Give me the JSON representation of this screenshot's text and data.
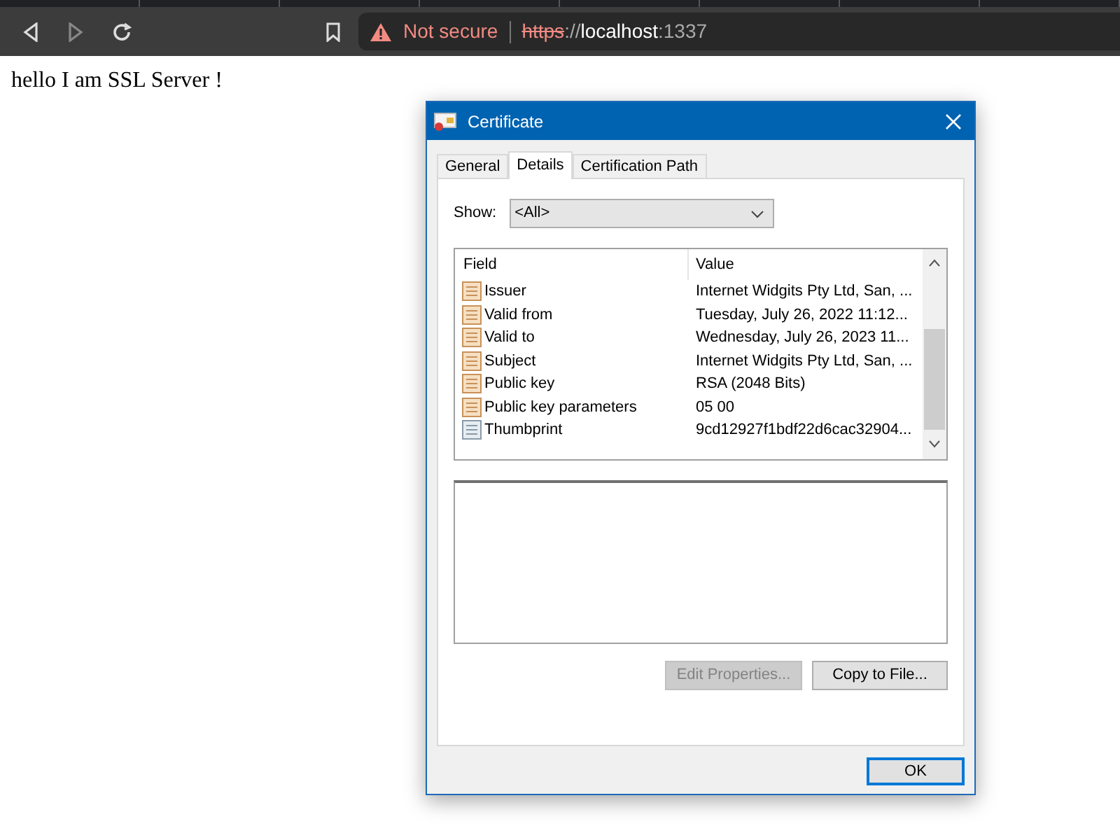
{
  "browser": {
    "security": "Not secure",
    "url_scheme": "https",
    "url_separator": "://",
    "url_host": "localhost",
    "url_port": ":1337",
    "back_disabled": false,
    "forward_disabled": true
  },
  "page": {
    "text": "hello I am SSL Server !"
  },
  "dialog": {
    "title": "Certificate",
    "tabs": [
      {
        "label": "General",
        "selected": false
      },
      {
        "label": "Details",
        "selected": true
      },
      {
        "label": "Certification Path",
        "selected": false
      }
    ],
    "show_label": "Show:",
    "show_value": "<All>",
    "columns": [
      "Field",
      "Value"
    ],
    "rows": [
      {
        "field": "Issuer",
        "value": "Internet Widgits Pty Ltd, San, ...",
        "kind": "extension"
      },
      {
        "field": "Valid from",
        "value": "Tuesday, July 26, 2022 11:12...",
        "kind": "extension"
      },
      {
        "field": "Valid to",
        "value": "Wednesday, July 26, 2023 11...",
        "kind": "extension"
      },
      {
        "field": "Subject",
        "value": "Internet Widgits Pty Ltd, San, ...",
        "kind": "extension"
      },
      {
        "field": "Public key",
        "value": "RSA (2048 Bits)",
        "kind": "extension"
      },
      {
        "field": "Public key parameters",
        "value": "05 00",
        "kind": "extension"
      },
      {
        "field": "Thumbprint",
        "value": "9cd12927f1bdf22d6cac32904...",
        "kind": "property"
      }
    ],
    "buttons": [
      {
        "label": "Edit Properties...",
        "disabled": true
      },
      {
        "label": "Copy to File...",
        "disabled": false
      }
    ],
    "ok": "OK"
  }
}
